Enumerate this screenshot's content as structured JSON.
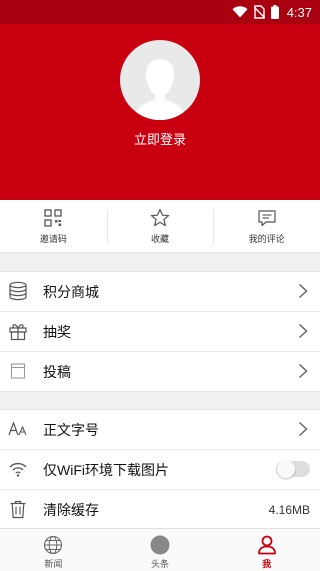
{
  "status_bar": {
    "time": "4:37",
    "icons": [
      "wifi-icon",
      "no-sim-icon",
      "battery-icon"
    ]
  },
  "profile": {
    "avatar_icon": "default-avatar-icon",
    "login_label": "立即登录"
  },
  "quick_actions": [
    {
      "icon": "qr-code-icon",
      "label": "邀请码"
    },
    {
      "icon": "star-icon",
      "label": "收藏"
    },
    {
      "icon": "comment-icon",
      "label": "我的评论"
    }
  ],
  "menu_group_1": [
    {
      "icon": "database-icon",
      "label": "积分商城"
    },
    {
      "icon": "gift-icon",
      "label": "抽奖"
    },
    {
      "icon": "contribute-icon",
      "label": "投稿"
    }
  ],
  "menu_group_2": {
    "font_size": {
      "icon": "font-size-icon",
      "label": "正文字号"
    },
    "wifi_images": {
      "icon": "wifi-icon",
      "label": "仅WiFi环境下载图片",
      "enabled": false
    },
    "clear_cache": {
      "icon": "trash-icon",
      "label": "清除缓存",
      "value": "4.16MB"
    }
  },
  "tab_bar": [
    {
      "icon": "globe-icon",
      "label": "新闻",
      "active": false
    },
    {
      "icon": "headline-icon",
      "label": "头条",
      "active": false
    },
    {
      "icon": "user-icon",
      "label": "我",
      "active": true
    }
  ],
  "colors": {
    "brand_red": "#c8000f",
    "status_bar": "#a8000f",
    "background": "#f0f0f0"
  }
}
